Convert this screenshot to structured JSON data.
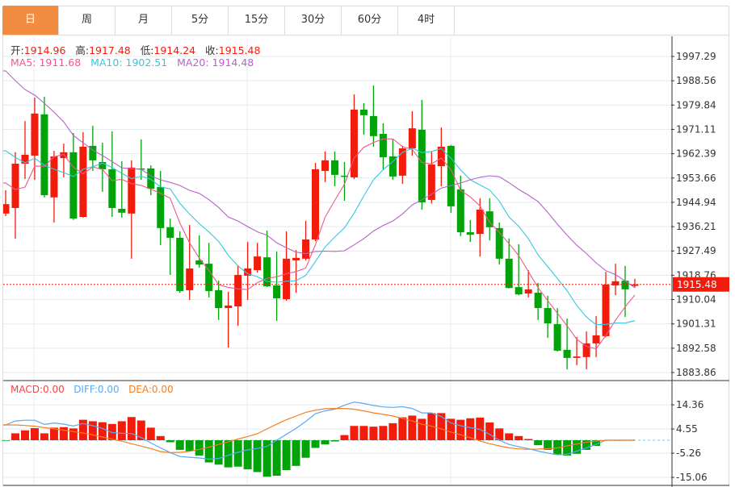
{
  "tabs": [
    {
      "label": "日",
      "active": true
    },
    {
      "label": "周"
    },
    {
      "label": "月"
    },
    {
      "label": "5分"
    },
    {
      "label": "15分"
    },
    {
      "label": "30分"
    },
    {
      "label": "60分"
    },
    {
      "label": "4时"
    }
  ],
  "ohlc_legend": {
    "open_label": "开:",
    "open": "1914.96",
    "high_label": "高:",
    "high": "1917.48",
    "low_label": "低:",
    "low": "1914.24",
    "close_label": "收:",
    "close": "1915.48"
  },
  "ma_legend": {
    "ma5": "MA5: 1911.68",
    "ma10": "MA10: 1902.51",
    "ma20": "MA20: 1914.48"
  },
  "macd_legend": {
    "macd": "MACD:0.00",
    "diff": "DIFF:0.00",
    "dea": "DEA:0.00"
  },
  "current_price": "1915.48",
  "colors": {
    "up": "#f21c0c",
    "down": "#02a20a",
    "ma5": "#ee5a8e",
    "ma10": "#36c6e0",
    "ma20": "#b763c8",
    "diff": "#5aa8f0",
    "dea": "#f57e20",
    "macd_label": "#f04545",
    "tab_active": "#f28c40",
    "grid": "#e3eaf0"
  },
  "chart_data": [
    {
      "type": "candlestick",
      "price_ticks": [
        "1997.29",
        "1988.56",
        "1979.84",
        "1971.11",
        "1962.39",
        "1953.66",
        "1944.94",
        "1936.21",
        "1927.49",
        "1918.76",
        "1910.04",
        "1901.31",
        "1892.58",
        "1883.86"
      ],
      "ylim": [
        1883.86,
        1997.29
      ],
      "grid": true,
      "candles_ohlc": [
        [
          1940.9,
          1949.3,
          1940.0,
          1944.3
        ],
        [
          1942.9,
          1962.9,
          1931.9,
          1958.8
        ],
        [
          1958.8,
          1974.1,
          1953.3,
          1962.0
        ],
        [
          1961.7,
          1982.5,
          1953.0,
          1976.8
        ],
        [
          1976.5,
          1982.8,
          1946.7,
          1947.5
        ],
        [
          1946.7,
          1963.4,
          1937.7,
          1961.4
        ],
        [
          1960.8,
          1966.0,
          1953.9,
          1962.9
        ],
        [
          1962.9,
          1969.8,
          1938.6,
          1939.1
        ],
        [
          1939.7,
          1970.1,
          1939.4,
          1964.9
        ],
        [
          1965.2,
          1972.4,
          1956.2,
          1960.0
        ],
        [
          1959.4,
          1966.3,
          1948.7,
          1956.8
        ],
        [
          1956.8,
          1970.4,
          1939.7,
          1942.9
        ],
        [
          1942.6,
          1959.7,
          1939.4,
          1941.2
        ],
        [
          1940.9,
          1960.0,
          1924.7,
          1957.4
        ],
        [
          1957.1,
          1967.5,
          1953.0,
          1956.8
        ],
        [
          1957.1,
          1958.2,
          1947.5,
          1949.8
        ],
        [
          1950.4,
          1956.2,
          1929.6,
          1935.7
        ],
        [
          1936.0,
          1939.1,
          1918.9,
          1932.2
        ],
        [
          1932.2,
          1934.5,
          1912.5,
          1913.1
        ],
        [
          1913.4,
          1936.8,
          1909.9,
          1921.2
        ],
        [
          1924.1,
          1933.1,
          1921.5,
          1922.6
        ],
        [
          1922.9,
          1930.4,
          1910.8,
          1913.1
        ],
        [
          1913.4,
          1916.8,
          1902.7,
          1907.0
        ],
        [
          1907.0,
          1912.8,
          1892.8,
          1907.9
        ],
        [
          1907.6,
          1922.4,
          1900.6,
          1918.9
        ],
        [
          1918.6,
          1930.7,
          1909.9,
          1921.2
        ],
        [
          1920.6,
          1930.4,
          1919.7,
          1925.5
        ],
        [
          1925.2,
          1934.8,
          1914.5,
          1914.8
        ],
        [
          1915.1,
          1927.3,
          1902.4,
          1910.5
        ],
        [
          1910.2,
          1934.5,
          1909.6,
          1924.7
        ],
        [
          1924.1,
          1927.8,
          1912.5,
          1925.0
        ],
        [
          1924.7,
          1938.3,
          1924.1,
          1931.6
        ],
        [
          1931.6,
          1959.1,
          1931.0,
          1956.8
        ],
        [
          1956.2,
          1963.2,
          1952.2,
          1960.0
        ],
        [
          1960.0,
          1963.2,
          1950.7,
          1954.8
        ],
        [
          1954.5,
          1959.4,
          1945.5,
          1954.2
        ],
        [
          1953.9,
          1983.7,
          1953.3,
          1978.2
        ],
        [
          1978.2,
          1980.5,
          1969.2,
          1976.2
        ],
        [
          1975.9,
          1986.9,
          1964.9,
          1968.7
        ],
        [
          1969.5,
          1973.3,
          1956.5,
          1961.1
        ],
        [
          1961.4,
          1967.5,
          1953.0,
          1954.2
        ],
        [
          1954.5,
          1965.2,
          1951.6,
          1964.3
        ],
        [
          1964.3,
          1977.6,
          1961.7,
          1971.5
        ],
        [
          1971.0,
          1981.7,
          1942.3,
          1944.9
        ],
        [
          1945.8,
          1963.2,
          1944.5,
          1958.5
        ],
        [
          1957.9,
          1971.8,
          1950.7,
          1964.9
        ],
        [
          1965.2,
          1965.5,
          1941.2,
          1943.5
        ],
        [
          1949.6,
          1954.5,
          1932.8,
          1934.2
        ],
        [
          1934.2,
          1938.6,
          1930.7,
          1933.3
        ],
        [
          1933.6,
          1946.4,
          1925.5,
          1942.3
        ],
        [
          1941.7,
          1946.4,
          1931.3,
          1936.0
        ],
        [
          1935.7,
          1937.7,
          1922.6,
          1924.7
        ],
        [
          1924.7,
          1932.0,
          1914.0,
          1914.2
        ],
        [
          1914.5,
          1929.9,
          1911.6,
          1911.9
        ],
        [
          1912.2,
          1920.6,
          1910.8,
          1913.7
        ],
        [
          1912.5,
          1916.0,
          1902.7,
          1907.0
        ],
        [
          1907.0,
          1911.4,
          1896.3,
          1901.5
        ],
        [
          1901.2,
          1907.0,
          1891.4,
          1891.7
        ],
        [
          1892.0,
          1903.2,
          1885.0,
          1889.1
        ],
        [
          1889.1,
          1896.6,
          1886.5,
          1889.6
        ],
        [
          1889.4,
          1898.6,
          1885.0,
          1894.3
        ],
        [
          1894.3,
          1904.1,
          1889.4,
          1897.2
        ],
        [
          1896.9,
          1920.0,
          1896.5,
          1915.4
        ],
        [
          1915.1,
          1922.9,
          1911.6,
          1916.6
        ],
        [
          1916.8,
          1922.1,
          1903.8,
          1913.7
        ],
        [
          1914.96,
          1917.48,
          1914.24,
          1915.48
        ]
      ],
      "moving_averages": [
        {
          "name": "MA5",
          "period": 5,
          "leading_values": [
            1951.9,
            1949.5,
            1950.4,
            1957.9
          ]
        },
        {
          "name": "MA10",
          "period": 10,
          "leading_values": [
            1963.4,
            1961.1,
            1959.1,
            1960.8,
            1958.2,
            1956.8,
            1955.6,
            1954.2,
            1956.8
          ]
        },
        {
          "name": "MA20",
          "period": 20,
          "leading_values": [
            1992.1,
            1988.6,
            1985.4,
            1983.4,
            1980.5,
            1977.3,
            1973.8,
            1968.9,
            1966.3,
            1963.7,
            1961.7,
            1959.6,
            1957.3,
            1957.0,
            1956.8,
            1954.4,
            1953.0,
            1952.1,
            1951.0
          ]
        }
      ]
    },
    {
      "type": "bar+line",
      "ticks": [
        "14.36",
        "4.55",
        "-5.26",
        "-15.06"
      ],
      "ylim": [
        -15.06,
        14.36
      ],
      "macd": [
        -0.2,
        2.8,
        4.0,
        4.9,
        2.8,
        5.1,
        5.3,
        4.8,
        8.3,
        7.7,
        7.3,
        6.6,
        7.7,
        9.4,
        8.0,
        5.1,
        1.7,
        -0.8,
        -3.9,
        -4.4,
        -6.2,
        -9.0,
        -9.9,
        -11.0,
        -10.7,
        -11.8,
        -12.9,
        -14.8,
        -14.4,
        -12.1,
        -10.4,
        -7.1,
        -3.1,
        -1.7,
        -0.5,
        2.1,
        5.8,
        5.8,
        5.5,
        5.8,
        6.9,
        9.3,
        10.0,
        8.7,
        11.0,
        11.0,
        8.7,
        8.3,
        8.9,
        9.2,
        7.2,
        4.8,
        2.8,
        1.7,
        0.5,
        -2.0,
        -3.9,
        -5.8,
        -6.2,
        -5.5,
        -3.9,
        -2.3,
        0,
        0,
        0,
        0
      ],
      "diff": [
        6.2,
        7.8,
        8.1,
        8.1,
        6.4,
        7.0,
        6.5,
        5.8,
        6.8,
        5.9,
        4.8,
        3.1,
        2.8,
        2.7,
        1.1,
        -1.1,
        -3.1,
        -5.0,
        -6.6,
        -6.9,
        -7.2,
        -7.7,
        -7.4,
        -6.1,
        -4.9,
        -3.9,
        -3.3,
        -2.5,
        0,
        2.4,
        4.8,
        7.6,
        10.8,
        11.9,
        12.6,
        14.2,
        15.5,
        14.9,
        14.1,
        13.5,
        13.3,
        13.6,
        12.9,
        11.1,
        11.1,
        9.6,
        7.0,
        5.9,
        5.1,
        4.4,
        2.4,
        0,
        -1.7,
        -2.6,
        -3.4,
        -4.4,
        -5.2,
        -5.9,
        -5.7,
        -4.4,
        -3.1,
        -1.7,
        0,
        0,
        0,
        0
      ],
      "dea": [
        6.2,
        6.2,
        6.0,
        5.7,
        5.1,
        4.6,
        4.1,
        3.5,
        2.9,
        2.2,
        1.3,
        0.4,
        -0.4,
        -1.4,
        -2.4,
        -3.4,
        -4.6,
        -5.0,
        -4.9,
        -4.5,
        -3.7,
        -2.8,
        -1.7,
        -0.7,
        0.5,
        1.5,
        2.6,
        4.6,
        6.5,
        8.3,
        9.8,
        11.3,
        12.2,
        12.8,
        12.9,
        12.9,
        12.6,
        11.9,
        11.1,
        10.5,
        9.8,
        8.9,
        7.8,
        6.5,
        5.7,
        4.6,
        3.3,
        2.2,
        1.0,
        -0.3,
        -1.4,
        -2.3,
        -3.1,
        -3.5,
        -3.7,
        -3.6,
        -3.4,
        -3.1,
        -2.3,
        -1.5,
        -0.8,
        -0.4,
        0,
        0,
        0,
        0
      ]
    }
  ]
}
